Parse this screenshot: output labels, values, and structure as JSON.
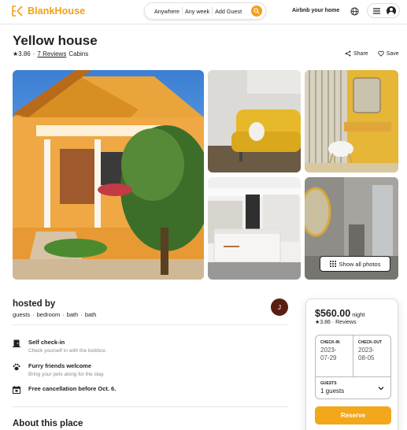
{
  "brand": {
    "name": "BlankHouse",
    "accent": "#f0a01a"
  },
  "search": {
    "where": "Anywhere",
    "when": "Any week",
    "who": "Add Guest",
    "icon": "search-icon"
  },
  "nav": {
    "host_link": "Airbnb your home",
    "globe_icon": "globe-icon",
    "menu_icon": "hamburger-icon",
    "avatar_icon": "user-avatar-icon"
  },
  "listing": {
    "title": "Yellow house",
    "rating": "★3.86",
    "dot": "·",
    "reviews": "7 Reviews",
    "category": "Cabins",
    "share": "Share",
    "save": "Save"
  },
  "gallery": {
    "show_all": "Show all photos",
    "photos": [
      "yellow-house-exterior",
      "yellow-sofa",
      "vanity-room",
      "modern-kitchen",
      "bathroom"
    ]
  },
  "host": {
    "heading": "hosted by",
    "facts": [
      "guests",
      "·",
      "bedroom",
      "·",
      "bath",
      "·",
      "bath"
    ],
    "avatar_initial": "J",
    "avatar_color": "#5a1d12"
  },
  "features": [
    {
      "icon": "door-icon",
      "title": "Self check-in",
      "sub": "Check yourself in with the lockbox."
    },
    {
      "icon": "paw-icon",
      "title": "Furry friends welcome",
      "sub": "Bring your pets along for the stay."
    },
    {
      "icon": "calendar-icon",
      "title": "Free cancellation before Oct. 6.",
      "sub": ""
    }
  ],
  "about": {
    "heading": "About this place"
  },
  "booking": {
    "price": "$560.00",
    "unit": "night",
    "rating": "★3.86 · Reviews",
    "checkin_label": "CHECK-IN",
    "checkin_value": "2023-07-29",
    "checkout_label": "CHECK-OUT",
    "checkout_value": "2023-08-05",
    "guests_label": "GUESTS",
    "guests_value": "1 guests",
    "reserve": "Reserve",
    "reserve_color": "#f3a71b"
  }
}
